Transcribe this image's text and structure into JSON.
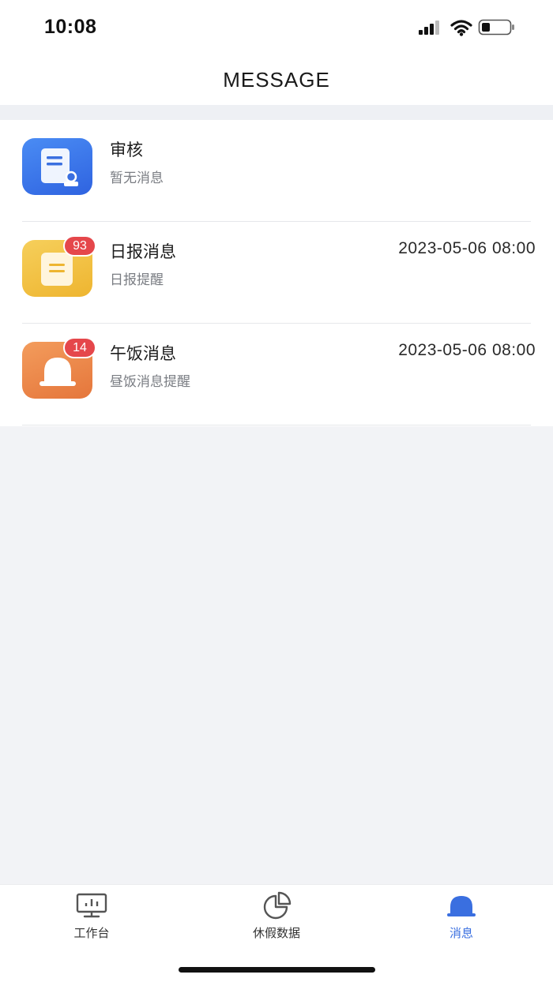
{
  "status_bar": {
    "time": "10:08"
  },
  "header": {
    "title": "MESSAGE"
  },
  "messages": [
    {
      "title": "审核",
      "subtitle": "暂无消息",
      "time": "",
      "badge": "",
      "icon": "audit-document-icon",
      "color": "#3b76ea"
    },
    {
      "title": "日报消息",
      "subtitle": "日报提醒",
      "time": "2023-05-06 08:00",
      "badge": "93",
      "icon": "daily-report-icon",
      "color": "#f2c244"
    },
    {
      "title": "午饭消息",
      "subtitle": "昼饭消息提醒",
      "time": "2023-05-06 08:00",
      "badge": "14",
      "icon": "bell-icon",
      "color": "#ec874a"
    }
  ],
  "tabbar": {
    "items": [
      {
        "label": "工作台",
        "icon": "workbench-monitor-icon",
        "active": false
      },
      {
        "label": "休假数据",
        "icon": "pie-chart-icon",
        "active": false
      },
      {
        "label": "消息",
        "icon": "bell-icon",
        "active": true
      }
    ],
    "active_color": "#3a6fe0"
  }
}
